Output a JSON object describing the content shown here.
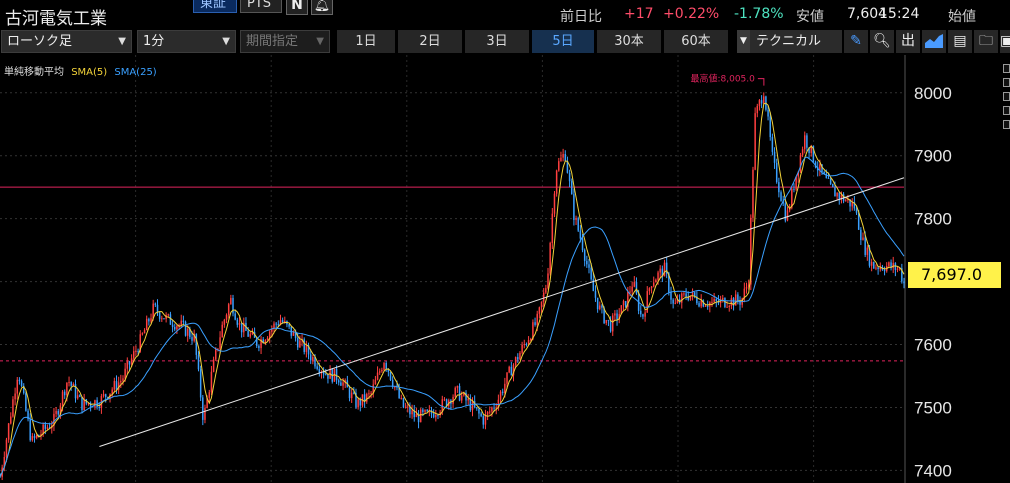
{
  "header": {
    "stock_name": "古河電気工業",
    "market_tabs": [
      "東証",
      "PTS"
    ],
    "icons": [
      "news-icon",
      "alert-bell-icon"
    ],
    "quote": {
      "prev_label": "前日比",
      "change": "+17",
      "change_pct": "+0.22%",
      "low_pct": "-1.78%",
      "low_label": "安値",
      "price": "7,604",
      "time": "15:24",
      "open_label": "始値"
    }
  },
  "toolbar": {
    "chart_type": "ローソク足",
    "interval": "1分",
    "range": "期間指定",
    "periods": [
      "1日",
      "2日",
      "3日",
      "5日",
      "30本",
      "60本"
    ],
    "active_period": "5日",
    "technical": "テクニカル",
    "tools": [
      "pencil-icon",
      "zoom-icon",
      "output-icon",
      "area-chart-icon",
      "save-icon",
      "folder-icon",
      "camera-icon"
    ]
  },
  "chart": {
    "legend_title": "単純移動平均",
    "sma5_label": "SMA(5)",
    "sma25_label": "SMA(25)",
    "max_label": "最高値:8,005.0",
    "current_price": "7,697.0",
    "y_ticks": [
      "8000",
      "7900",
      "7800",
      "7700",
      "7600",
      "7500",
      "7400"
    ],
    "colors": {
      "up": "#ff3f3f",
      "down": "#3aa0ff",
      "sma5": "#f3d339",
      "sma25": "#3aa0ff",
      "hline": "#e0245e",
      "trend": "#e8e8e8",
      "badge": "#fff24a"
    }
  },
  "chart_data": {
    "type": "candlestick",
    "interval": "1分",
    "ylim": [
      7380,
      8060
    ],
    "y_ticks": [
      8000,
      7900,
      7800,
      7700,
      7600,
      7500,
      7400
    ],
    "series": [
      {
        "name": "SMA(5)"
      },
      {
        "name": "SMA(25)"
      }
    ],
    "path": [
      [
        0,
        7390
      ],
      [
        0.02,
        7560
      ],
      [
        0.035,
        7445
      ],
      [
        0.06,
        7480
      ],
      [
        0.075,
        7545
      ],
      [
        0.09,
        7505
      ],
      [
        0.11,
        7510
      ],
      [
        0.135,
        7545
      ],
      [
        0.155,
        7605
      ],
      [
        0.17,
        7658
      ],
      [
        0.185,
        7640
      ],
      [
        0.2,
        7630
      ],
      [
        0.215,
        7610
      ],
      [
        0.225,
        7480
      ],
      [
        0.235,
        7560
      ],
      [
        0.245,
        7625
      ],
      [
        0.255,
        7672
      ],
      [
        0.265,
        7630
      ],
      [
        0.285,
        7602
      ],
      [
        0.31,
        7640
      ],
      [
        0.33,
        7605
      ],
      [
        0.345,
        7580
      ],
      [
        0.36,
        7555
      ],
      [
        0.375,
        7548
      ],
      [
        0.395,
        7505
      ],
      [
        0.41,
        7520
      ],
      [
        0.425,
        7577
      ],
      [
        0.445,
        7502
      ],
      [
        0.46,
        7485
      ],
      [
        0.475,
        7488
      ],
      [
        0.49,
        7505
      ],
      [
        0.505,
        7525
      ],
      [
        0.52,
        7505
      ],
      [
        0.535,
        7480
      ],
      [
        0.55,
        7510
      ],
      [
        0.565,
        7560
      ],
      [
        0.58,
        7600
      ],
      [
        0.595,
        7640
      ],
      [
        0.605,
        7700
      ],
      [
        0.615,
        7880
      ],
      [
        0.625,
        7905
      ],
      [
        0.635,
        7805
      ],
      [
        0.645,
        7755
      ],
      [
        0.655,
        7690
      ],
      [
        0.665,
        7650
      ],
      [
        0.675,
        7630
      ],
      [
        0.69,
        7660
      ],
      [
        0.7,
        7700
      ],
      [
        0.71,
        7640
      ],
      [
        0.72,
        7700
      ],
      [
        0.735,
        7720
      ],
      [
        0.745,
        7660
      ],
      [
        0.76,
        7680
      ],
      [
        0.775,
        7670
      ],
      [
        0.79,
        7665
      ],
      [
        0.805,
        7670
      ],
      [
        0.82,
        7670
      ],
      [
        0.828,
        7700
      ],
      [
        0.835,
        7960
      ],
      [
        0.845,
        8005
      ],
      [
        0.855,
        7890
      ],
      [
        0.87,
        7800
      ],
      [
        0.89,
        7930
      ],
      [
        0.905,
        7880
      ],
      [
        0.92,
        7845
      ],
      [
        0.935,
        7830
      ],
      [
        0.945,
        7820
      ],
      [
        0.955,
        7760
      ],
      [
        0.965,
        7725
      ],
      [
        0.98,
        7725
      ],
      [
        0.995,
        7720
      ],
      [
        1,
        7697
      ]
    ],
    "max": 8005,
    "max_label": "最高値:8,005.0",
    "last": 7697,
    "hlines": [
      {
        "value": 7850,
        "style": "solid",
        "color": "#e0245e"
      },
      {
        "value": 7574,
        "style": "dashed",
        "color": "#e0245e"
      }
    ],
    "trendline": [
      [
        0.11,
        7438
      ],
      [
        1.0,
        7865
      ]
    ]
  }
}
